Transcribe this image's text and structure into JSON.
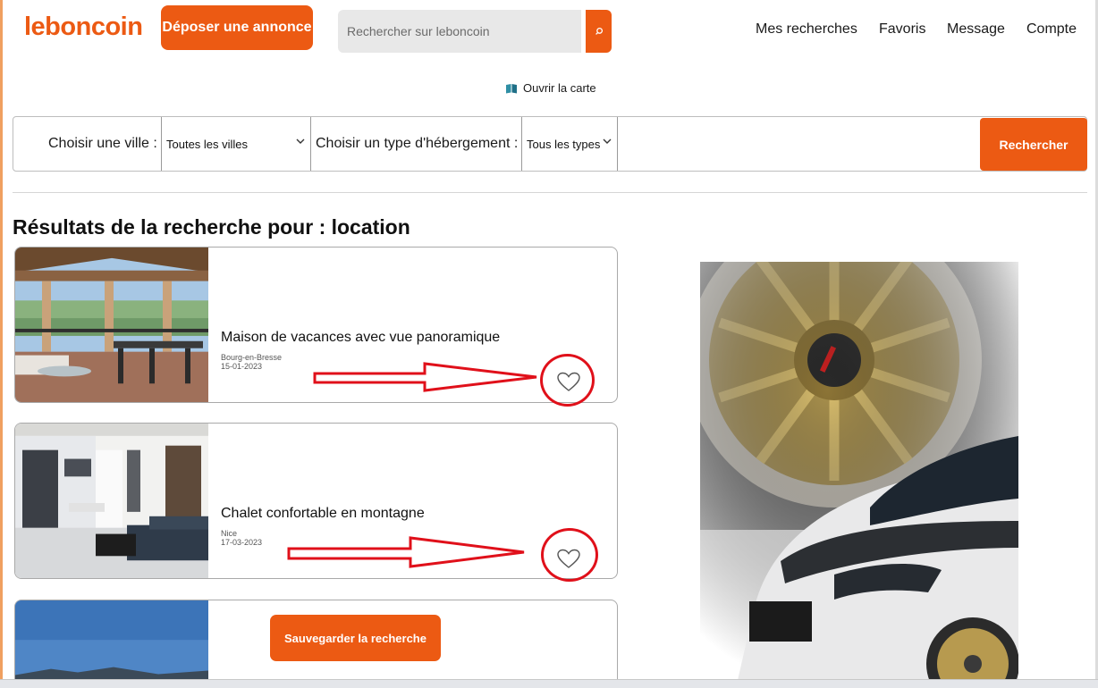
{
  "header": {
    "logo": "leboncoin",
    "deposit_label": "Déposer une annonce",
    "search_placeholder": "Rechercher sur leboncoin",
    "nav": [
      "Mes recherches",
      "Favoris",
      "Message",
      "Compte"
    ]
  },
  "map_link": {
    "label": "Ouvrir la carte",
    "icon": "map-book-icon"
  },
  "filters": {
    "city_label": "Choisir une ville :",
    "city_value": "Toutes les villes",
    "type_label": "Choisir un type d'hébergement :",
    "type_value": "Tous les types",
    "search_label": "Rechercher"
  },
  "results": {
    "title": "Résultats de la recherche pour : location",
    "listings": [
      {
        "title": "Maison de vacances avec vue panoramique",
        "city": "Bourg-en-Bresse",
        "date": "15-01-2023",
        "image": "terrace-with-view"
      },
      {
        "title": "Chalet confortable en montagne",
        "city": "Nice",
        "date": "17-03-2023",
        "image": "modern-living-room"
      },
      {
        "title": "",
        "city": "",
        "date": "",
        "image": "blue-sky-mountains"
      }
    ],
    "save_search_label": "Sauvegarder la recherche"
  },
  "advertisement": {
    "image": "gold-wheel-white-car"
  },
  "colors": {
    "brand": "#ec5a13",
    "annotation": "#e0101a"
  }
}
